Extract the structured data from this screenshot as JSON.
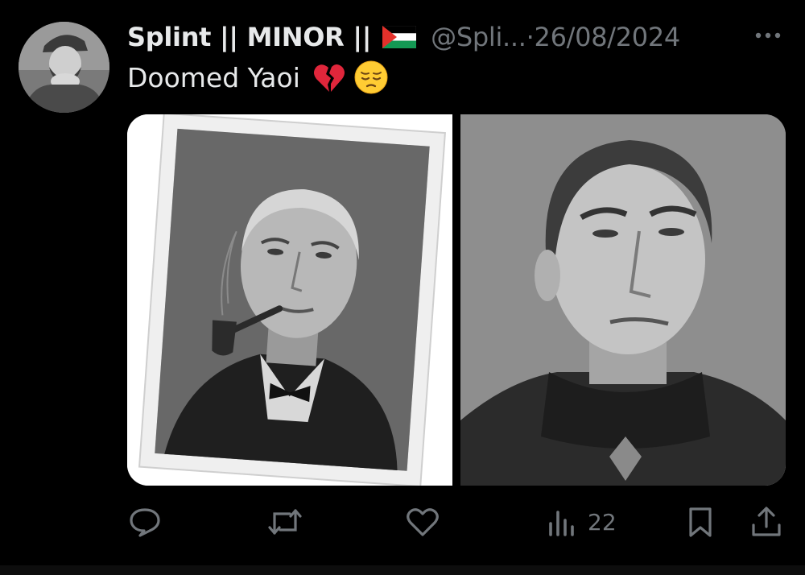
{
  "tweet": {
    "display_name": "Splint || MINOR ||",
    "flag_icon": "palestine-flag-icon",
    "handle": "@Spli...",
    "separator": " · ",
    "date": "26/08/2024",
    "text": "Doomed Yaoi",
    "emojis": [
      "broken-heart-icon",
      "pensive-face-icon"
    ],
    "media": [
      {
        "icon": "portrait-with-pipe-image"
      },
      {
        "icon": "stern-officer-portrait-image"
      }
    ]
  },
  "actions": {
    "reply_icon": "reply-icon",
    "retweet_icon": "retweet-icon",
    "like_icon": "heart-icon",
    "views_icon": "views-icon",
    "views_count": "22",
    "bookmark_icon": "bookmark-icon",
    "share_icon": "share-icon"
  },
  "colors": {
    "background": "#000000",
    "text": "#e7e9ea",
    "muted": "#71767b"
  }
}
